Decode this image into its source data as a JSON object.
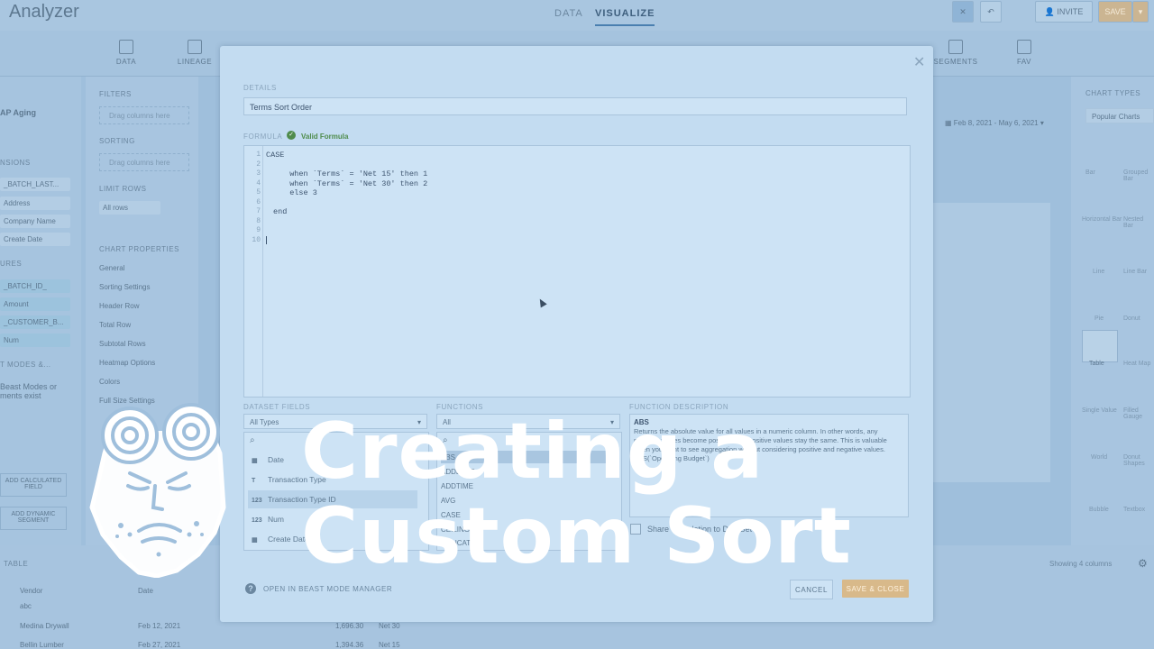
{
  "app": {
    "title": "Analyzer",
    "tabs": [
      "DATA",
      "VISUALIZE"
    ],
    "invite_label": "INVITE",
    "save_label": "SAVE"
  },
  "ribbon": [
    "DATA",
    "LINEAGE",
    "SEGMENTS",
    "FAV"
  ],
  "left_column": {
    "dataset": "AP Aging",
    "dimensions_label": "NSIONS",
    "dimensions": [
      "_BATCH_LAST...",
      "Address",
      "Company Name",
      "Create Date"
    ],
    "measures_label": "URES",
    "measures": [
      "_BATCH_ID_",
      "Amount",
      "_CUSTOMER_B...",
      "Num"
    ],
    "beastmodes_label": "T MODES &...",
    "beastmodes_empty": "Beast Modes or ments exist",
    "add_calc": "ADD CALCULATED FIELD",
    "add_dyn": "ADD DYNAMIC SEGMENT"
  },
  "filter_column": {
    "filters": "FILTERS",
    "filters_ph": "Drag columns here",
    "sorting": "SORTING",
    "sorting_ph": "Drag columns here",
    "limit_rows": "LIMIT ROWS",
    "all_rows": "All rows",
    "chart_props": "CHART PROPERTIES",
    "props": [
      "General",
      "Sorting Settings",
      "Header Row",
      "Total Row",
      "Subtotal Rows",
      "Heatmap Options",
      "Colors",
      "Full Size Settings"
    ]
  },
  "right_panel": {
    "label": "CHART TYPES",
    "select": "Popular Charts",
    "types": [
      "Bar",
      "Grouped Bar",
      "Horizontal Bar",
      "Nested Bar",
      "Line",
      "Line Bar",
      "Pie",
      "Donut",
      "Table",
      "Heat Map",
      "Single Value",
      "Filled Gauge",
      "World",
      "Donut Shapes",
      "Bubble",
      "Textbox"
    ]
  },
  "date_range": "Feb 8, 2021 - May 6, 2021",
  "bottom": {
    "label": "TABLE",
    "showing": "Showing 4 columns",
    "col_vendor": "Vendor",
    "col_date": "Date",
    "vendor_filter": "abc",
    "rows": [
      {
        "vendor": "Medina Drywall",
        "date": "Feb 12, 2021",
        "amount": "1,696.30",
        "terms": "Net 30"
      },
      {
        "vendor": "Bellin Lumber",
        "date": "Feb 27, 2021",
        "amount": "1,394.36",
        "terms": "Net 15"
      }
    ]
  },
  "modal": {
    "details_label": "DETAILS",
    "name_value": "Terms Sort Order",
    "formula_label": "FORMULA",
    "valid_label": "Valid Formula",
    "line_numbers": [
      "1",
      "2",
      "3",
      "4",
      "5",
      "6",
      "7",
      "8",
      "9",
      "10"
    ],
    "code_lines": [
      "CASE",
      "",
      "  when `Terms` = 'Net 15' then 1",
      "  when `Terms` = 'Net 30' then 2",
      "  else 3",
      "",
      "end",
      "",
      "",
      ""
    ],
    "dataset_fields_label": "DATASET FIELDS",
    "dataset_select": "All Types",
    "fields": [
      {
        "type": "▦",
        "name": "Date"
      },
      {
        "type": "T",
        "name": "Transaction Type"
      },
      {
        "type": "123",
        "name": "Transaction Type ID"
      },
      {
        "type": "123",
        "name": "Num"
      },
      {
        "type": "▦",
        "name": "Create Date"
      }
    ],
    "functions_label": "FUNCTIONS",
    "functions_select": "All",
    "functions": [
      "ABS",
      "ADDDATE",
      "ADDTIME",
      "AVG",
      "CASE",
      "CEILING",
      "CONCAT"
    ],
    "desc_label": "FUNCTION DESCRIPTION",
    "desc_title": "ABS",
    "desc_text": "Returns the absolute value for all values in a numeric column. In other words, any negative values become positive, and positive values stay the same. This is valuable when you want to see aggregation without considering positive and negative values.",
    "desc_example": "ABS(`Operating Budget`)",
    "share_label": "Share Calculation to DataSet",
    "open_manager": "OPEN IN BEAST MODE MANAGER",
    "cancel": "CANCEL",
    "save_close": "SAVE & CLOSE"
  },
  "overlay": {
    "line1": "Creating a",
    "line2": "Custom Sort"
  },
  "colors": {
    "accent": "#4a7fb0",
    "save": "#d8b98a",
    "valid": "#4f8c4c"
  }
}
